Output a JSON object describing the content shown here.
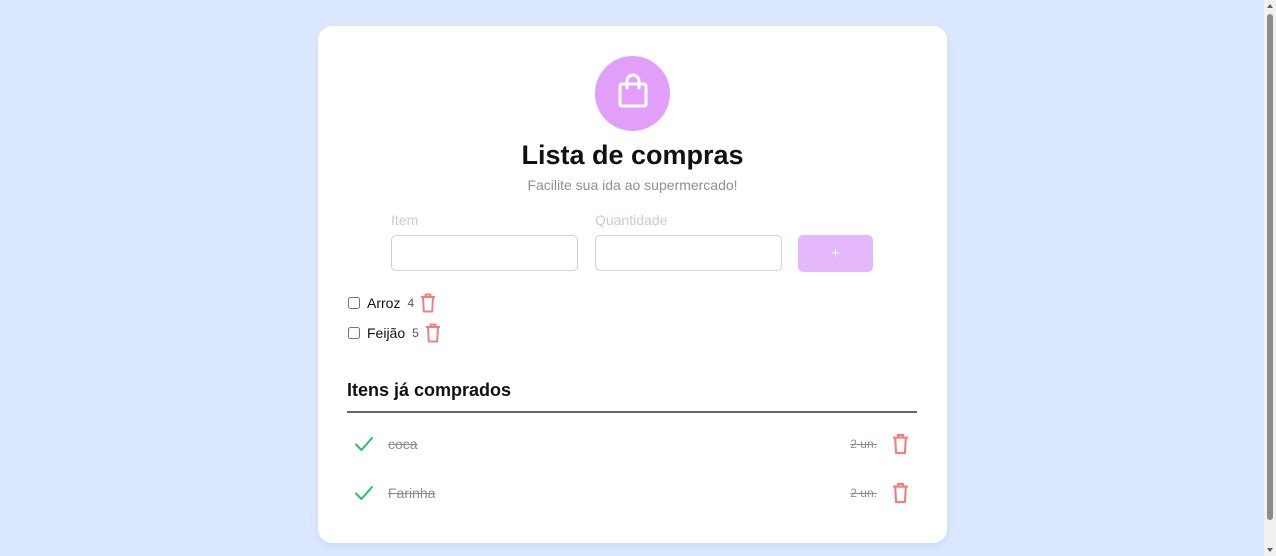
{
  "header": {
    "logo_icon": "shopping-bag-icon",
    "logo_color": "#e19ffa",
    "title": "Lista de compras",
    "subtitle": "Facilite sua ida ao supermercado!"
  },
  "form": {
    "item_label": "Item",
    "item_value": "",
    "quantity_label": "Quantidade",
    "quantity_value": "",
    "add_button_label": "+",
    "add_button_color": "#e5b7fb"
  },
  "pending_items": [
    {
      "name": "Arroz",
      "quantity": "4",
      "checked": false
    },
    {
      "name": "Feijão",
      "quantity": "5",
      "checked": false
    }
  ],
  "bought": {
    "heading": "Itens já comprados",
    "items": [
      {
        "name": "coca",
        "quantity": "2 un."
      },
      {
        "name": "Farinha",
        "quantity": "2 un."
      }
    ]
  },
  "colors": {
    "background": "#dbe8fd",
    "trash": "#f08080",
    "check": "#22c55e"
  }
}
